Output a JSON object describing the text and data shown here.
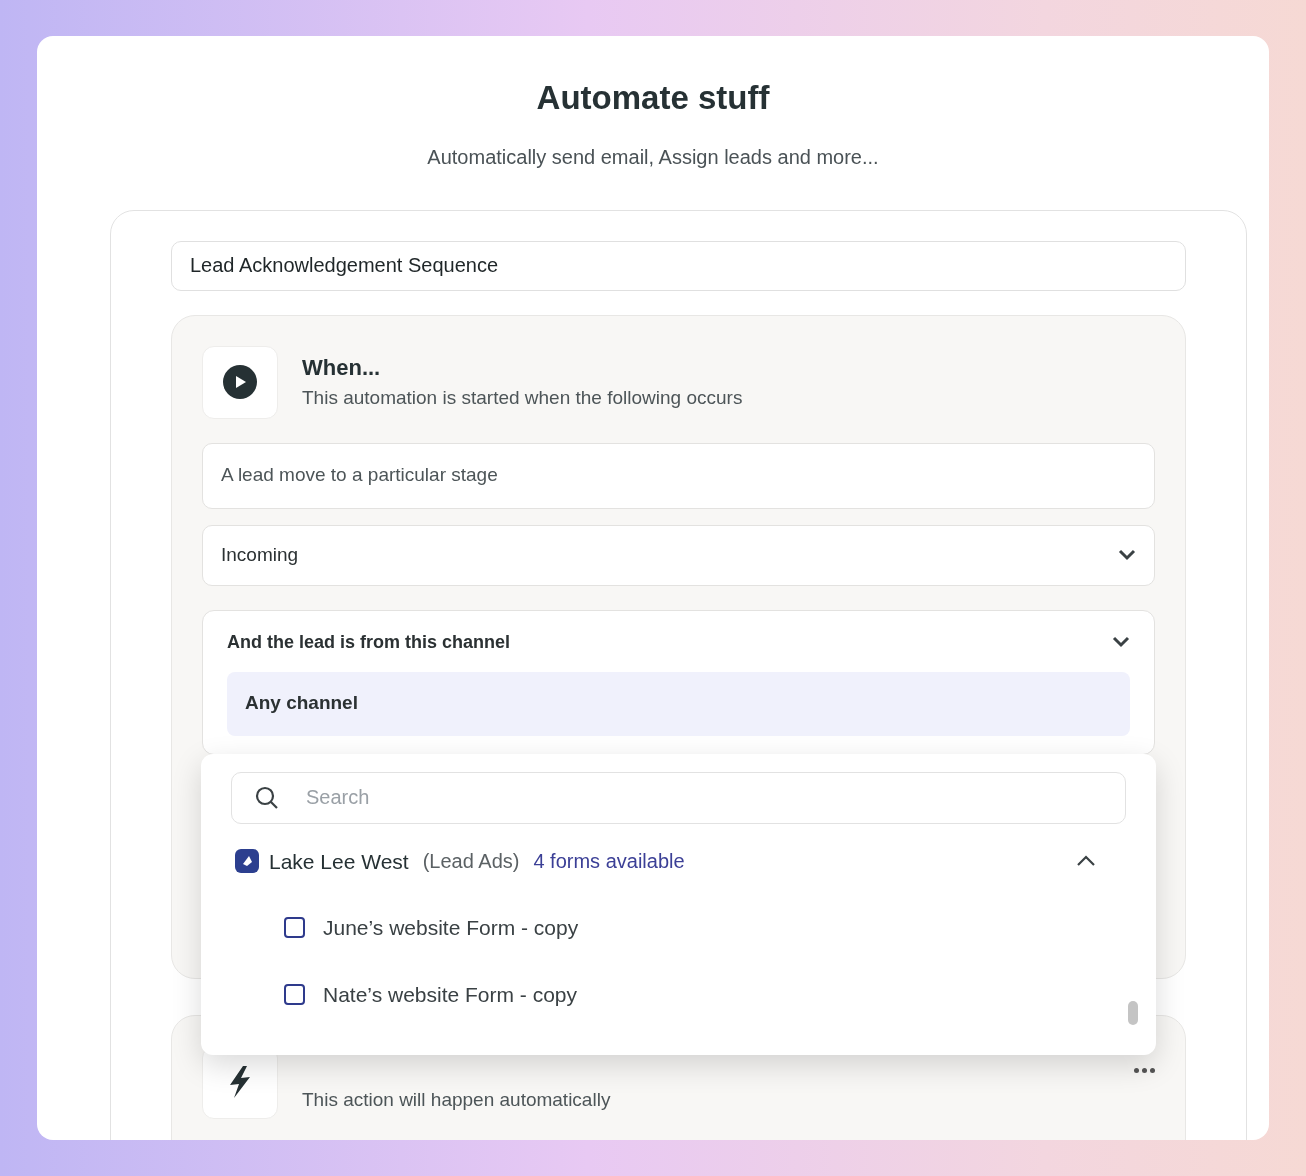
{
  "header": {
    "title": "Automate stuff",
    "subtitle": "Automatically send email, Assign leads and more..."
  },
  "automation_name": {
    "value": "Lead Acknowledgement Sequence"
  },
  "when": {
    "title": "When...",
    "subtitle": "This automation is started when the following occurs",
    "trigger": "A lead move to a particular stage",
    "stage": {
      "value": "Incoming"
    },
    "channel": {
      "label": "And the lead is from this channel",
      "expanded": true,
      "selected_option": "Any channel"
    }
  },
  "dropdown": {
    "search": {
      "placeholder": "Search"
    },
    "group": {
      "name": "Lake Lee West",
      "source": "(Lead Ads)",
      "count": "4 forms available",
      "expanded": true,
      "items": [
        {
          "label": "June’s website Form - copy",
          "checked": false
        },
        {
          "label": "Nate’s website Form - copy",
          "checked": false
        }
      ]
    }
  },
  "then": {
    "subtitle": "This action will happen automatically"
  }
}
